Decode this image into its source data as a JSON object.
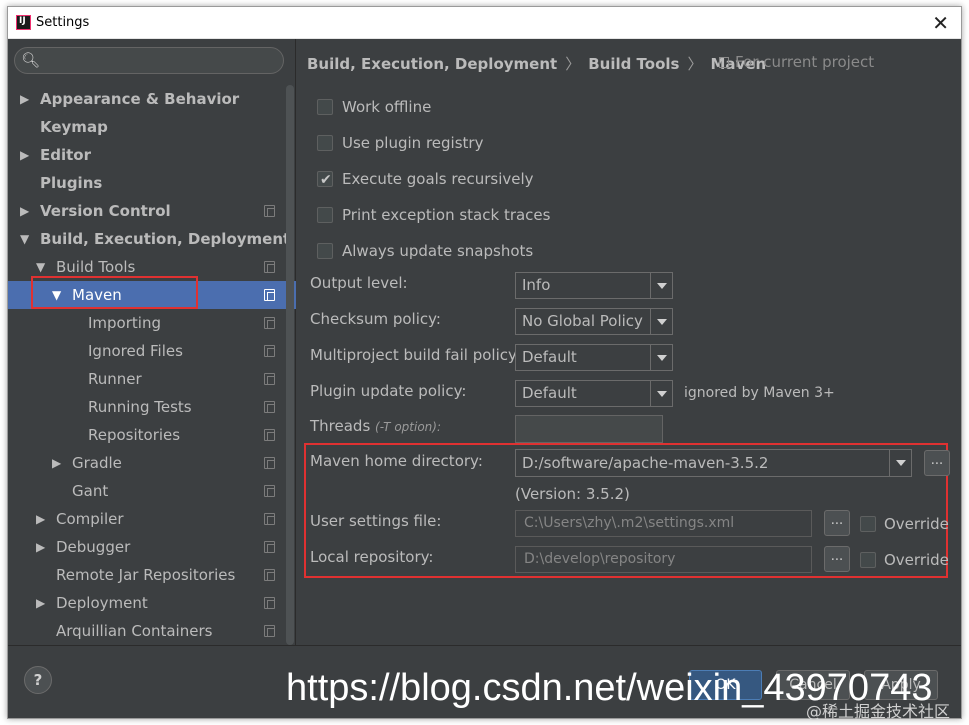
{
  "window": {
    "title": "Settings",
    "close_glyph": "✕"
  },
  "sidebar": {
    "search_icon": "🔍︎",
    "items": [
      {
        "label": "Appearance & Behavior",
        "arrow": "▶",
        "bold": true
      },
      {
        "label": "Keymap",
        "bold": true
      },
      {
        "label": "Editor",
        "arrow": "▶",
        "bold": true
      },
      {
        "label": "Plugins",
        "bold": true
      },
      {
        "label": "Version Control",
        "arrow": "▶",
        "bold": true
      },
      {
        "label": "Build, Execution, Deployment",
        "arrow": "▼",
        "bold": true
      },
      {
        "label": "Build Tools",
        "arrow": "▼"
      },
      {
        "label": "Maven",
        "arrow": "▼",
        "selected": true
      },
      {
        "label": "Importing"
      },
      {
        "label": "Ignored Files"
      },
      {
        "label": "Runner"
      },
      {
        "label": "Running Tests"
      },
      {
        "label": "Repositories"
      },
      {
        "label": "Gradle",
        "arrow": "▶"
      },
      {
        "label": "Gant"
      },
      {
        "label": "Compiler",
        "arrow": "▶"
      },
      {
        "label": "Debugger",
        "arrow": "▶"
      },
      {
        "label": "Remote Jar Repositories"
      },
      {
        "label": "Deployment",
        "arrow": "▶"
      },
      {
        "label": "Arquillian Containers"
      }
    ]
  },
  "breadcrumb": {
    "part1": "Build, Execution, Deployment",
    "part2": "Build Tools",
    "part3": "Maven",
    "separator": "〉",
    "project_note": "For current project"
  },
  "checkboxes": [
    {
      "label": "Work offline",
      "checked": false
    },
    {
      "label": "Use plugin registry",
      "checked": false
    },
    {
      "label": "Execute goals recursively",
      "checked": true
    },
    {
      "label": "Print exception stack traces",
      "checked": false
    },
    {
      "label": "Always update snapshots",
      "checked": false
    }
  ],
  "form": {
    "output_level_label": "Output level:",
    "output_level_value": "Info",
    "checksum_label": "Checksum policy:",
    "checksum_value": "No Global Policy",
    "fail_policy_label": "Multiproject build fail policy:",
    "fail_policy_value": "Default",
    "plugin_update_label": "Plugin update policy:",
    "plugin_update_value": "Default",
    "plugin_update_note": "ignored by Maven 3+",
    "threads_label": "Threads",
    "threads_hint": "(-T option):",
    "threads_value": ""
  },
  "maven": {
    "home_label": "Maven home directory:",
    "home_value": "D:/software/apache-maven-3.5.2",
    "version": "(Version: 3.5.2)",
    "user_settings_label": "User settings file:",
    "user_settings_value": "C:\\Users\\zhy\\.m2\\settings.xml",
    "local_repo_label": "Local repository:",
    "local_repo_value": "D:\\develop\\repository",
    "override_label": "Override",
    "browse_glyph": "..."
  },
  "buttons": {
    "help": "?",
    "ok": "OK",
    "cancel": "Cancel",
    "apply": "Apply"
  },
  "watermark": {
    "url": "https://blog.csdn.net/weixin_43970743",
    "credit": "@稀土掘金技术社区"
  },
  "colors": {
    "dark_bg": "#3c3f41",
    "selection": "#4b6eaf",
    "highlight_box": "#e03131"
  }
}
